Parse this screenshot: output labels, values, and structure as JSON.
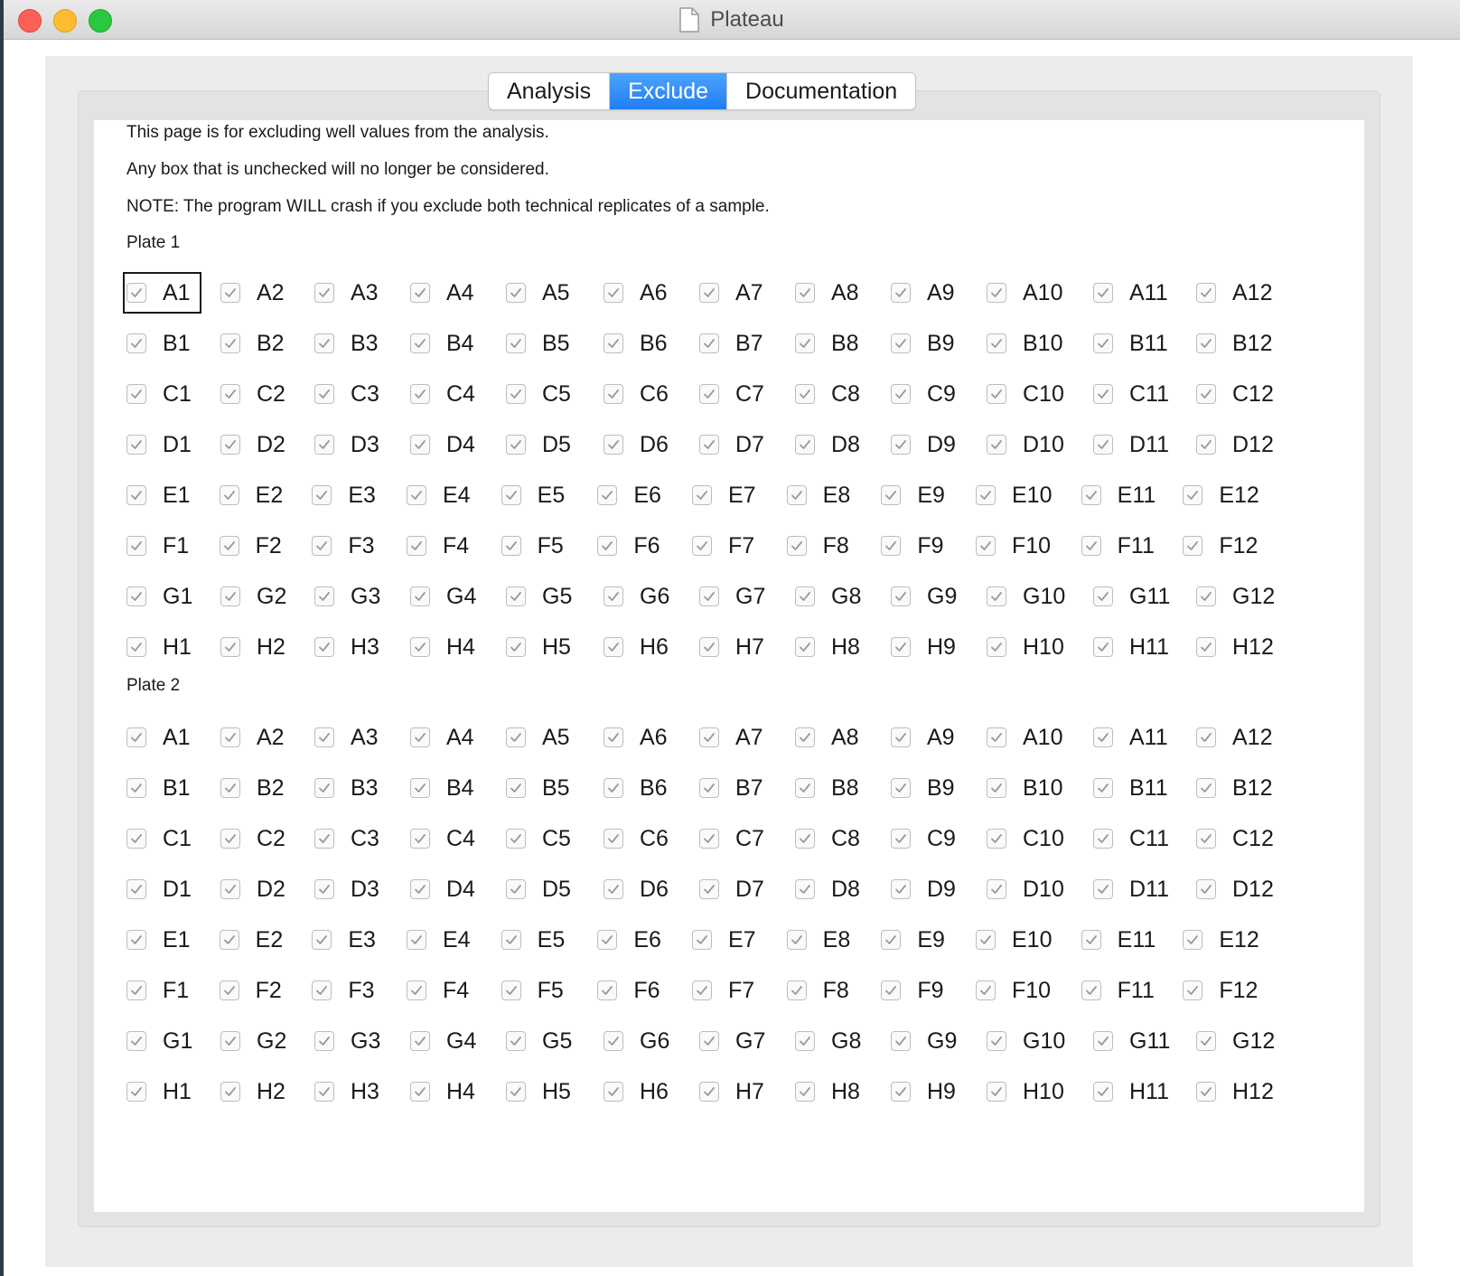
{
  "window": {
    "title": "Plateau"
  },
  "tabs": [
    {
      "label": "Analysis",
      "active": false
    },
    {
      "label": "Exclude",
      "active": true
    },
    {
      "label": "Documentation",
      "active": false
    }
  ],
  "info": [
    "This page is for excluding well values from the analysis.",
    "Any box that is unchecked will no longer be considered.",
    "NOTE: The program WILL crash if you exclude both technical replicates of a sample."
  ],
  "plates": [
    {
      "label": "Plate 1",
      "rows": [
        "A",
        "B",
        "C",
        "D",
        "E",
        "F",
        "G",
        "H"
      ],
      "columns": 12,
      "focused_well": "A1",
      "all_checked": true
    },
    {
      "label": "Plate 2",
      "rows": [
        "A",
        "B",
        "C",
        "D",
        "E",
        "F",
        "G",
        "H"
      ],
      "columns": 12,
      "all_checked": true
    }
  ],
  "colors": {
    "tab_active": "#1f7ff1",
    "checkbox_border": "#bdbdbd",
    "checkmark": "#9a9a9a"
  }
}
